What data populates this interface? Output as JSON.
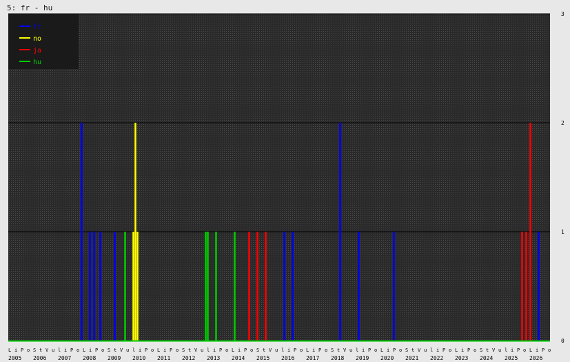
{
  "chart_data": {
    "type": "bar",
    "title": "5: fr - hu",
    "ylim": [
      0,
      3
    ],
    "yticks": [
      "0",
      "1",
      "2",
      "3"
    ],
    "grid": true,
    "legend_position": "top-left",
    "x_start": "2005-01",
    "x_end": "2026-10",
    "years": [
      "2005",
      "2006",
      "2007",
      "2008",
      "2009",
      "2010",
      "2011",
      "2012",
      "2013",
      "2014",
      "2015",
      "2016",
      "2017",
      "2018",
      "2019",
      "2020",
      "2021",
      "2022",
      "2023",
      "2024",
      "2025",
      "2026"
    ],
    "month_labels": [
      "L",
      "i",
      "P",
      "o",
      "S",
      "t",
      "V",
      "u",
      "l",
      "i",
      "P",
      "o"
    ],
    "colors": {
      "plot_bg": "#2a2a2a",
      "grid": "#000000",
      "baseline": "#00cc00",
      "page": "#e8e8e8"
    },
    "series": [
      {
        "name": "fr",
        "color": "#0000ff",
        "points": [
          {
            "x": "2007-12",
            "y": 2
          },
          {
            "x": "2008-04",
            "y": 1
          },
          {
            "x": "2008-06",
            "y": 1
          },
          {
            "x": "2008-09",
            "y": 1
          },
          {
            "x": "2009-04",
            "y": 1
          },
          {
            "x": "2016-02",
            "y": 1
          },
          {
            "x": "2016-06",
            "y": 1
          },
          {
            "x": "2018-05",
            "y": 2
          },
          {
            "x": "2019-02",
            "y": 1
          },
          {
            "x": "2020-07",
            "y": 1
          },
          {
            "x": "2026-05",
            "y": 1
          }
        ]
      },
      {
        "name": "no",
        "color": "#ffff00",
        "points": [
          {
            "x": "2010-01",
            "y": 1
          },
          {
            "x": "2010-02",
            "y": 2
          },
          {
            "x": "2010-03",
            "y": 1
          }
        ]
      },
      {
        "name": "ja",
        "color": "#ff0000",
        "points": [
          {
            "x": "2014-09",
            "y": 1
          },
          {
            "x": "2015-01",
            "y": 1
          },
          {
            "x": "2015-05",
            "y": 1
          },
          {
            "x": "2025-09",
            "y": 1
          },
          {
            "x": "2025-11",
            "y": 1
          },
          {
            "x": "2026-01",
            "y": 2
          }
        ]
      },
      {
        "name": "hu",
        "color": "#00cc00",
        "points": [
          {
            "x": "2009-09",
            "y": 1
          },
          {
            "x": "2012-12",
            "y": 1
          },
          {
            "x": "2013-01",
            "y": 1
          },
          {
            "x": "2013-05",
            "y": 1
          },
          {
            "x": "2014-02",
            "y": 1
          }
        ]
      }
    ]
  }
}
